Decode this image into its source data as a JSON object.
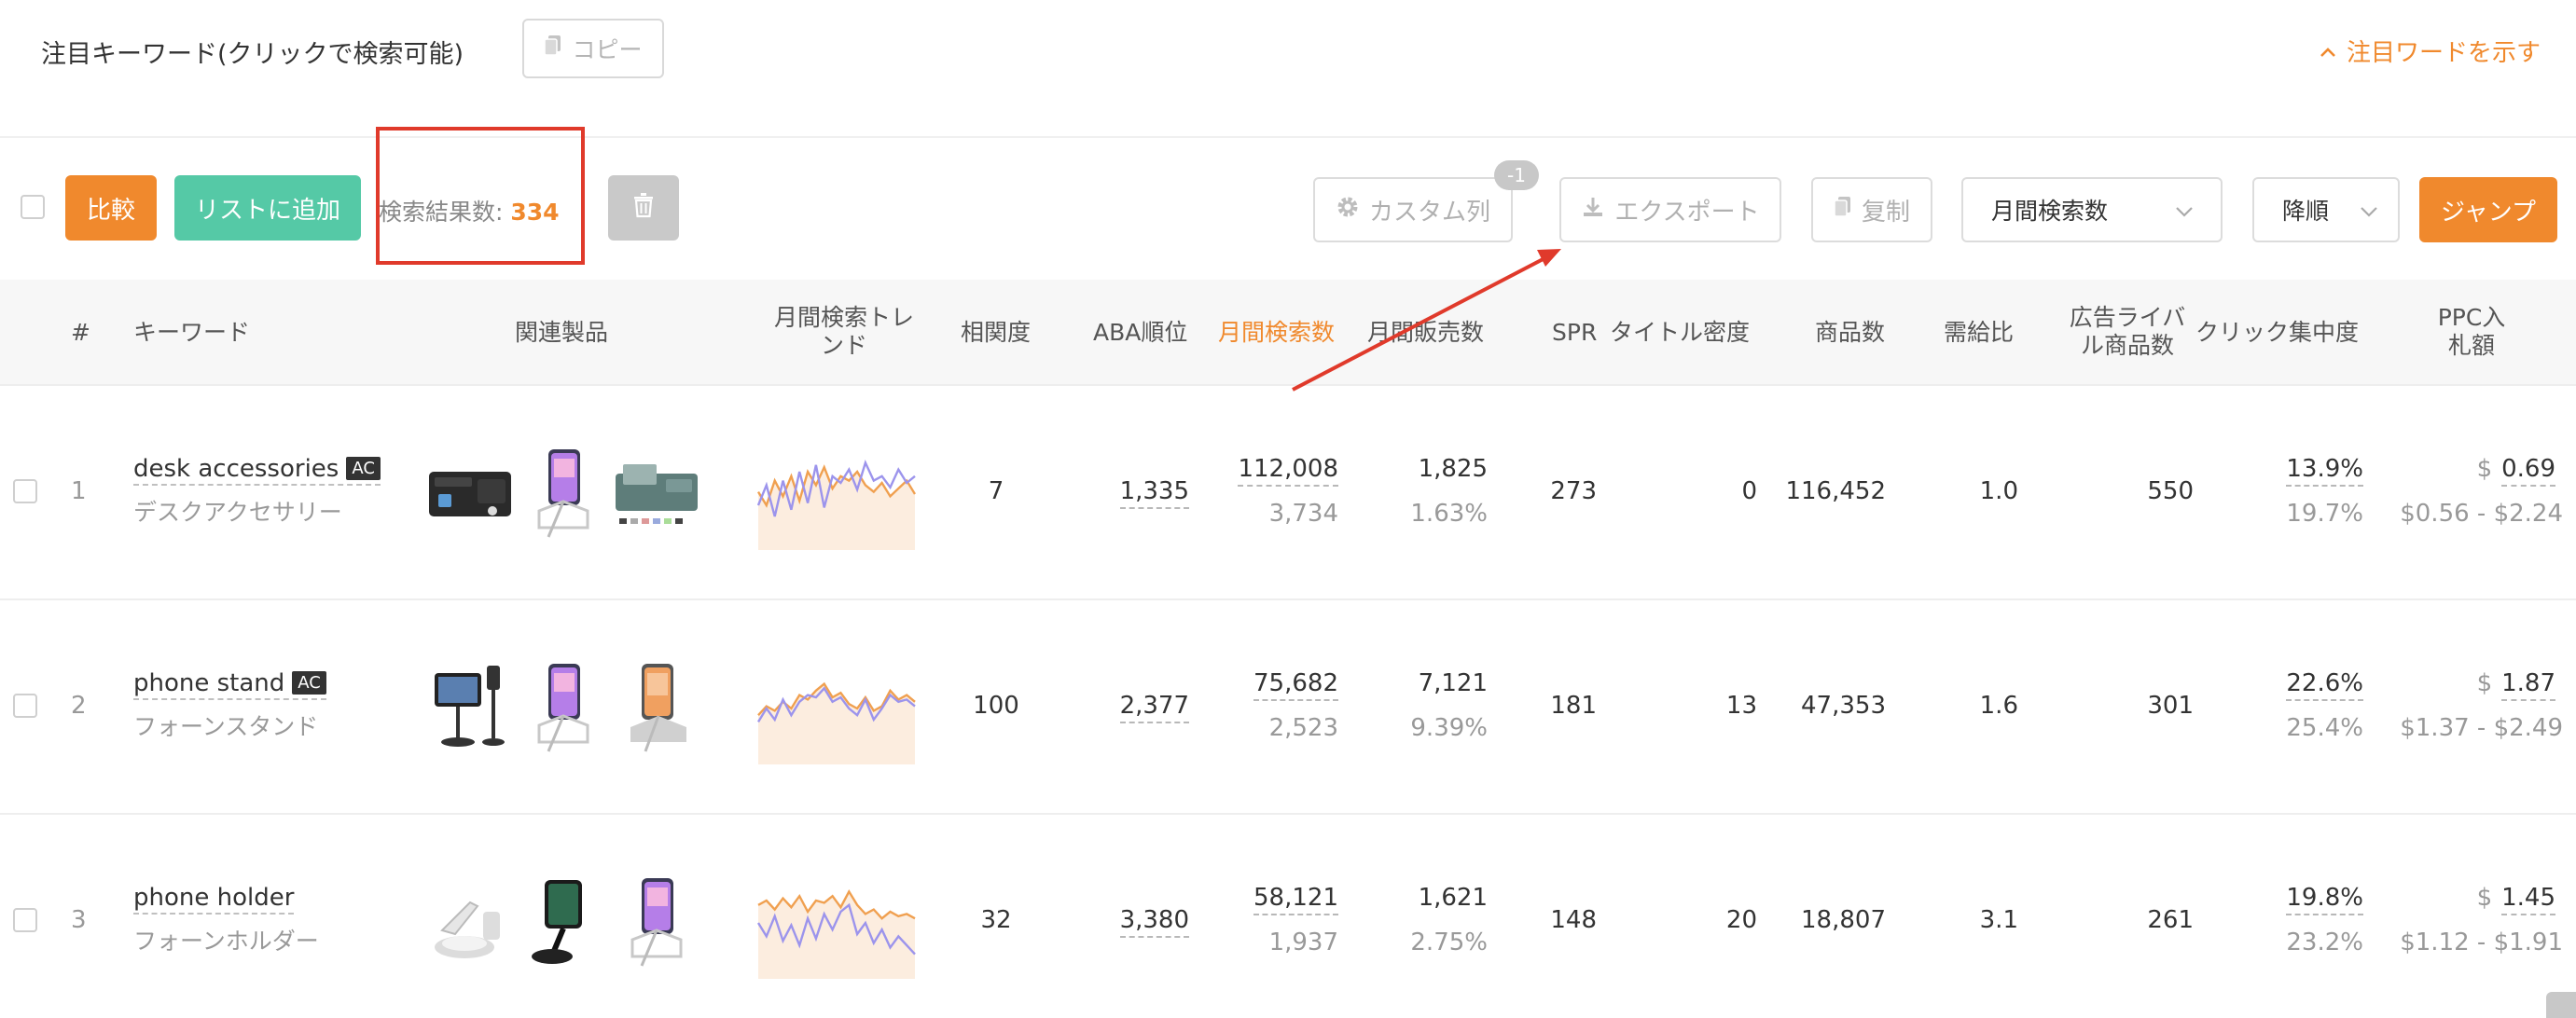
{
  "header": {
    "title": "注目キーワード(クリックで検索可能)",
    "copy_label": "コピー",
    "show_words_label": "注目ワードを示す"
  },
  "toolbar": {
    "compare_label": "比較",
    "add_to_list_label": "リストに追加",
    "result_count_label": "検索結果数:",
    "result_count_value": "334",
    "custom_columns_label": "カスタム列",
    "custom_columns_badge": "-1",
    "export_label": "エクスポート",
    "duplicate_label": "复制",
    "sort_field_value": "月間検索数",
    "sort_order_value": "降順",
    "jump_label": "ジャンプ"
  },
  "table": {
    "columns": {
      "index": "#",
      "keyword": "キーワード",
      "products": "関連製品",
      "trend_line1": "月間検索トレ",
      "trend_line2": "ンド",
      "relevance": "相関度",
      "aba_rank": "ABA順位",
      "monthly_searches": "月間検索数",
      "monthly_sales": "月間販売数",
      "spr": "SPR",
      "title_density": "タイトル密度",
      "product_count": "商品数",
      "supply_demand": "需給比",
      "ad_rivals_line1": "広告ライバ",
      "ad_rivals_line2": "ル商品数",
      "click_concentration": "クリック集中度",
      "ppc_line1": "PPC入",
      "ppc_line2": "札額"
    },
    "rows": [
      {
        "index": "1",
        "keyword": "desk accessories",
        "badge": "AC",
        "keyword_jp": "デスクアクセサリー",
        "relevance": "7",
        "aba_rank": "1,335",
        "monthly_searches": "112,008",
        "monthly_searches_sub": "3,734",
        "monthly_sales": "1,825",
        "monthly_sales_sub": "1.63%",
        "spr": "273",
        "title_density": "0",
        "product_count": "116,452",
        "supply_demand": "1.0",
        "ad_rivals": "550",
        "click_concentration": "13.9%",
        "click_concentration_sub": "19.7%",
        "ppc_currency": "$",
        "ppc": "0.69",
        "ppc_range": "$0.56 - $2.24",
        "products": [
          "desk-pad-set",
          "phone-stand",
          "desk-mat"
        ],
        "trend": {
          "orange": [
            52,
            40,
            62,
            48,
            66,
            44,
            70,
            58,
            74,
            55,
            66,
            62,
            70,
            58,
            52,
            60,
            48,
            55,
            62,
            50
          ],
          "purple": [
            40,
            58,
            30,
            62,
            36,
            70,
            42,
            76,
            38,
            66,
            60,
            72,
            54,
            78,
            62,
            66,
            56,
            72,
            60,
            66
          ]
        }
      },
      {
        "index": "2",
        "keyword": "phone stand",
        "badge": "AC",
        "keyword_jp": "フォーンスタンド",
        "relevance": "100",
        "aba_rank": "2,377",
        "monthly_searches": "75,682",
        "monthly_searches_sub": "2,523",
        "monthly_sales": "7,121",
        "monthly_sales_sub": "9.39%",
        "spr": "181",
        "title_density": "13",
        "product_count": "47,353",
        "supply_demand": "1.6",
        "ad_rivals": "301",
        "click_concentration": "22.6%",
        "click_concentration_sub": "25.4%",
        "ppc_currency": "$",
        "ppc": "1.87",
        "ppc_range": "$1.37 - $2.49",
        "products": [
          "tablet-stand",
          "phone-stand",
          "aluminum-stand"
        ],
        "trend": {
          "orange": [
            44,
            52,
            48,
            56,
            50,
            62,
            58,
            66,
            72,
            60,
            64,
            54,
            50,
            60,
            48,
            52,
            66,
            58,
            62,
            56
          ],
          "purple": [
            38,
            50,
            40,
            58,
            44,
            56,
            62,
            60,
            68,
            56,
            60,
            50,
            44,
            58,
            40,
            50,
            62,
            56,
            58,
            52
          ]
        }
      },
      {
        "index": "3",
        "keyword": "phone holder",
        "badge": "",
        "keyword_jp": "フォーンホルダー",
        "relevance": "32",
        "aba_rank": "3,380",
        "monthly_searches": "58,121",
        "monthly_searches_sub": "1,937",
        "monthly_sales": "1,621",
        "monthly_sales_sub": "2.75%",
        "spr": "148",
        "title_density": "20",
        "product_count": "18,807",
        "supply_demand": "3.1",
        "ad_rivals": "261",
        "click_concentration": "19.8%",
        "click_concentration_sub": "23.2%",
        "ppc_currency": "$",
        "ppc": "1.45",
        "ppc_range": "$1.12 - $1.91",
        "products": [
          "charging-stand",
          "car-mount",
          "phone-stand"
        ],
        "trend": {
          "orange": [
            66,
            70,
            62,
            72,
            64,
            74,
            60,
            70,
            68,
            74,
            64,
            78,
            66,
            58,
            62,
            54,
            60,
            56,
            58,
            54
          ],
          "purple": [
            50,
            38,
            56,
            34,
            48,
            30,
            54,
            36,
            58,
            44,
            60,
            66,
            40,
            50,
            32,
            44,
            28,
            38,
            30,
            22
          ]
        }
      }
    ]
  },
  "colors": {
    "accent": "#f0892d",
    "green": "#55c9a6",
    "annotation_red": "#e03a2b",
    "trend_orange": "#f0a050",
    "trend_purple": "#9c94ec"
  }
}
